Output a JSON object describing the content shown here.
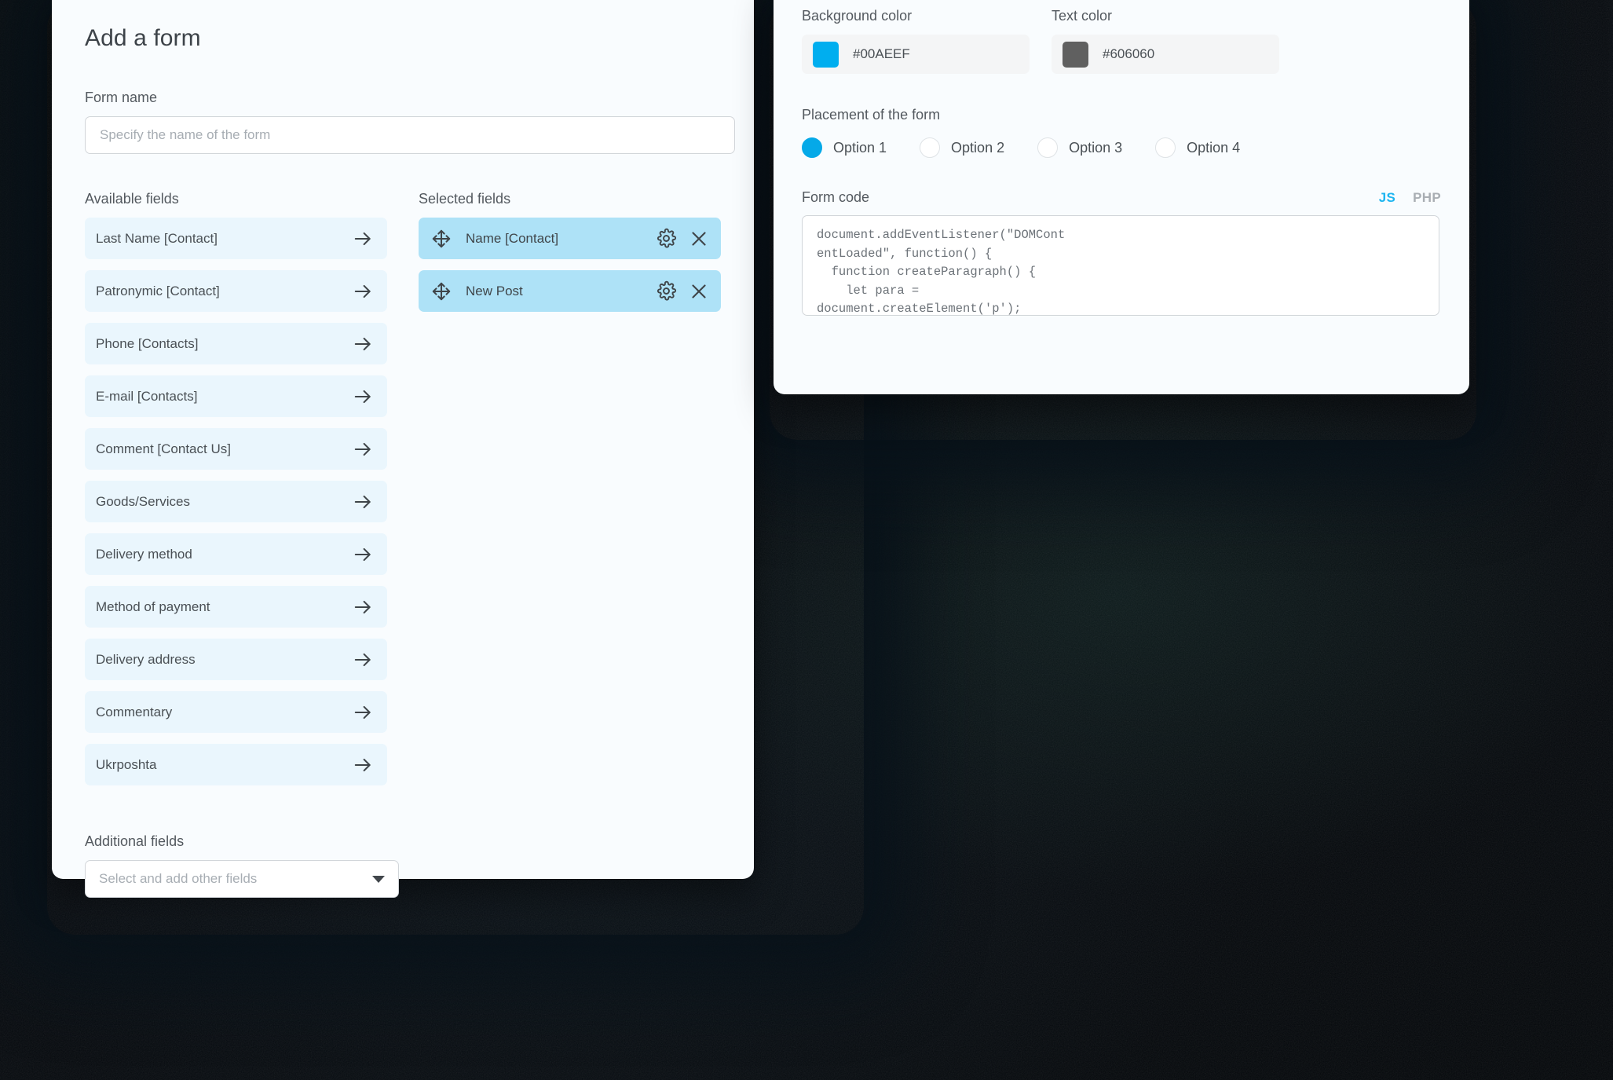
{
  "left_card": {
    "title": "Add a form",
    "form_name": {
      "label": "Form name",
      "value": "",
      "placeholder": "Specify the name of the form"
    },
    "available": {
      "heading": "Available fields",
      "items": [
        {
          "label": "Last Name [Contact]"
        },
        {
          "label": "Patronymic [Contact]"
        },
        {
          "label": "Phone [Contacts]"
        },
        {
          "label": "E-mail [Contacts]"
        },
        {
          "label": "Comment [Contact Us]"
        },
        {
          "label": "Goods/Services"
        },
        {
          "label": "Delivery method"
        },
        {
          "label": "Method of payment"
        },
        {
          "label": "Delivery address"
        },
        {
          "label": "Commentary"
        },
        {
          "label": "Ukrposhta"
        }
      ],
      "row_icon": "arrow-right-icon"
    },
    "selected": {
      "heading": "Selected fields",
      "items": [
        {
          "label": "Name [Contact]"
        },
        {
          "label": "New Post"
        }
      ],
      "drag_icon": "move-icon",
      "settings_icon": "gear-icon",
      "remove_icon": "close-icon"
    },
    "additional": {
      "label": "Additional fields",
      "placeholder": "Select and add other fields",
      "caret_icon": "chevron-down-icon"
    }
  },
  "right_card": {
    "background_color": {
      "label": "Background color",
      "value": "#00AEEF",
      "swatch": "#00AEEF"
    },
    "text_color": {
      "label": "Text color",
      "value": "#606060",
      "swatch": "#606060"
    },
    "placement": {
      "label": "Placement of the form",
      "options": [
        {
          "label": "Option 1",
          "selected": true
        },
        {
          "label": "Option 2",
          "selected": false
        },
        {
          "label": "Option 3",
          "selected": false
        },
        {
          "label": "Option 4",
          "selected": false
        }
      ],
      "selected_color": "#05A9E8"
    },
    "form_code": {
      "label": "Form code",
      "tabs": [
        {
          "label": "JS",
          "active": true
        },
        {
          "label": "PHP",
          "active": false
        }
      ],
      "active_tab_color": "#1EB5F0",
      "code": "document.addEventListener(\"DOMCont\nentLoaded\", function() {\n  function createParagraph() {\n    let para =\ndocument.createElement('p');"
    }
  },
  "theme": {
    "card_background": "#F9FCFE",
    "available_row_background": "#EAF6FD",
    "selected_row_background": "#AEE2F7",
    "backdrop": "#050709"
  }
}
